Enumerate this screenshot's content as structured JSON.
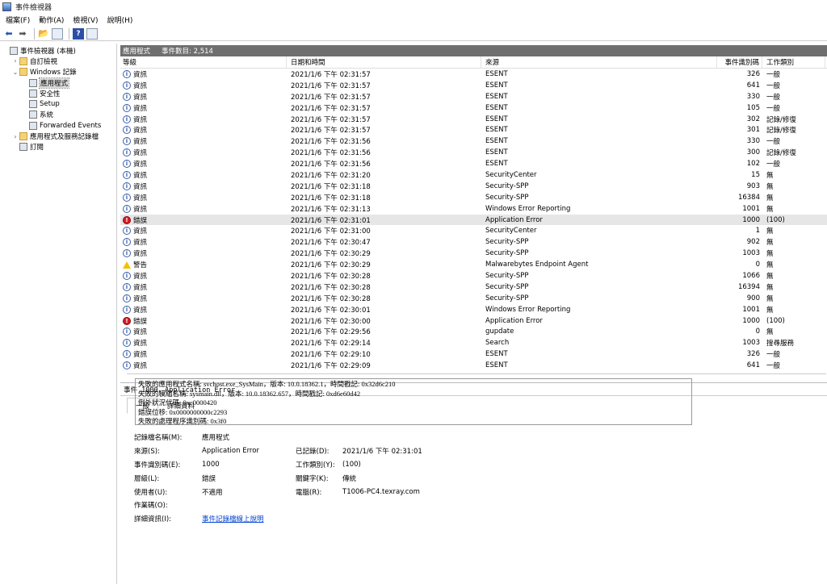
{
  "window": {
    "title": "事件檢視器"
  },
  "menu": [
    "檔案(F)",
    "動作(A)",
    "檢視(V)",
    "說明(H)"
  ],
  "tree": [
    {
      "label": "事件檢視器 (本機)",
      "arrow": "",
      "indent": 0,
      "icon": "app"
    },
    {
      "label": "自訂檢視",
      "arrow": "›",
      "indent": 1,
      "icon": "folder"
    },
    {
      "label": "Windows 記錄",
      "arrow": "⌄",
      "indent": 1,
      "icon": "folder"
    },
    {
      "label": "應用程式",
      "arrow": "",
      "indent": 2,
      "icon": "log",
      "selected": true
    },
    {
      "label": "安全性",
      "arrow": "",
      "indent": 2,
      "icon": "log"
    },
    {
      "label": "Setup",
      "arrow": "",
      "indent": 2,
      "icon": "log"
    },
    {
      "label": "系統",
      "arrow": "",
      "indent": 2,
      "icon": "log"
    },
    {
      "label": "Forwarded Events",
      "arrow": "",
      "indent": 2,
      "icon": "log"
    },
    {
      "label": "應用程式及服務記錄檔",
      "arrow": "›",
      "indent": 1,
      "icon": "folder"
    },
    {
      "label": "訂閱",
      "arrow": "",
      "indent": 1,
      "icon": "log"
    }
  ],
  "pane": {
    "log_name": "應用程式",
    "count_label": "事件數目: 2,514"
  },
  "columns": [
    "等級",
    "日期和時間",
    "來源",
    "事件識別碼",
    "工作類別"
  ],
  "events": [
    {
      "level": "info",
      "level_label": "資訊",
      "time": "2021/1/6 下午 02:31:57",
      "source": "ESENT",
      "id": "326",
      "task": "一般"
    },
    {
      "level": "info",
      "level_label": "資訊",
      "time": "2021/1/6 下午 02:31:57",
      "source": "ESENT",
      "id": "641",
      "task": "一般"
    },
    {
      "level": "info",
      "level_label": "資訊",
      "time": "2021/1/6 下午 02:31:57",
      "source": "ESENT",
      "id": "330",
      "task": "一般"
    },
    {
      "level": "info",
      "level_label": "資訊",
      "time": "2021/1/6 下午 02:31:57",
      "source": "ESENT",
      "id": "105",
      "task": "一般"
    },
    {
      "level": "info",
      "level_label": "資訊",
      "time": "2021/1/6 下午 02:31:57",
      "source": "ESENT",
      "id": "302",
      "task": "記錄/修復"
    },
    {
      "level": "info",
      "level_label": "資訊",
      "time": "2021/1/6 下午 02:31:57",
      "source": "ESENT",
      "id": "301",
      "task": "記錄/修復"
    },
    {
      "level": "info",
      "level_label": "資訊",
      "time": "2021/1/6 下午 02:31:56",
      "source": "ESENT",
      "id": "330",
      "task": "一般"
    },
    {
      "level": "info",
      "level_label": "資訊",
      "time": "2021/1/6 下午 02:31:56",
      "source": "ESENT",
      "id": "300",
      "task": "記錄/修復"
    },
    {
      "level": "info",
      "level_label": "資訊",
      "time": "2021/1/6 下午 02:31:56",
      "source": "ESENT",
      "id": "102",
      "task": "一般"
    },
    {
      "level": "info",
      "level_label": "資訊",
      "time": "2021/1/6 下午 02:31:20",
      "source": "SecurityCenter",
      "id": "15",
      "task": "無"
    },
    {
      "level": "info",
      "level_label": "資訊",
      "time": "2021/1/6 下午 02:31:18",
      "source": "Security-SPP",
      "id": "903",
      "task": "無"
    },
    {
      "level": "info",
      "level_label": "資訊",
      "time": "2021/1/6 下午 02:31:18",
      "source": "Security-SPP",
      "id": "16384",
      "task": "無"
    },
    {
      "level": "info",
      "level_label": "資訊",
      "time": "2021/1/6 下午 02:31:13",
      "source": "Windows Error Reporting",
      "id": "1001",
      "task": "無"
    },
    {
      "level": "err",
      "level_label": "錯誤",
      "time": "2021/1/6 下午 02:31:01",
      "source": "Application Error",
      "id": "1000",
      "task": "(100)",
      "highlight": true
    },
    {
      "level": "info",
      "level_label": "資訊",
      "time": "2021/1/6 下午 02:31:00",
      "source": "SecurityCenter",
      "id": "1",
      "task": "無"
    },
    {
      "level": "info",
      "level_label": "資訊",
      "time": "2021/1/6 下午 02:30:47",
      "source": "Security-SPP",
      "id": "902",
      "task": "無"
    },
    {
      "level": "info",
      "level_label": "資訊",
      "time": "2021/1/6 下午 02:30:29",
      "source": "Security-SPP",
      "id": "1003",
      "task": "無"
    },
    {
      "level": "warn",
      "level_label": "警告",
      "time": "2021/1/6 下午 02:30:29",
      "source": "Malwarebytes Endpoint Agent",
      "id": "0",
      "task": "無"
    },
    {
      "level": "info",
      "level_label": "資訊",
      "time": "2021/1/6 下午 02:30:28",
      "source": "Security-SPP",
      "id": "1066",
      "task": "無"
    },
    {
      "level": "info",
      "level_label": "資訊",
      "time": "2021/1/6 下午 02:30:28",
      "source": "Security-SPP",
      "id": "16394",
      "task": "無"
    },
    {
      "level": "info",
      "level_label": "資訊",
      "time": "2021/1/6 下午 02:30:28",
      "source": "Security-SPP",
      "id": "900",
      "task": "無"
    },
    {
      "level": "info",
      "level_label": "資訊",
      "time": "2021/1/6 下午 02:30:01",
      "source": "Windows Error Reporting",
      "id": "1001",
      "task": "無"
    },
    {
      "level": "err",
      "level_label": "錯誤",
      "time": "2021/1/6 下午 02:30:00",
      "source": "Application Error",
      "id": "1000",
      "task": "(100)"
    },
    {
      "level": "info",
      "level_label": "資訊",
      "time": "2021/1/6 下午 02:29:56",
      "source": "gupdate",
      "id": "0",
      "task": "無"
    },
    {
      "level": "info",
      "level_label": "資訊",
      "time": "2021/1/6 下午 02:29:14",
      "source": "Search",
      "id": "1003",
      "task": "搜尋服務"
    },
    {
      "level": "info",
      "level_label": "資訊",
      "time": "2021/1/6 下午 02:29:10",
      "source": "ESENT",
      "id": "326",
      "task": "一般"
    },
    {
      "level": "info",
      "level_label": "資訊",
      "time": "2021/1/6 下午 02:29:09",
      "source": "ESENT",
      "id": "641",
      "task": "一般"
    }
  ],
  "detail": {
    "header": "事件 1000，Application Error",
    "tabs": [
      "一般",
      "詳細資料"
    ],
    "description": [
      "失敗的應用程式名稱: svchost.exe_SysMain，版本: 10.0.18362.1，時間戳記: 0x32d6c210",
      "失敗的模組名稱: sysmain.dll，版本: 10.0.18362.657，時間戳記: 0xd6e60d42",
      "例外狀況代碼: 0xc0000420",
      "錯誤位移: 0x0000000000c2293",
      "失敗的處理程序識別碼: 0x3f0"
    ],
    "props": {
      "log_name_label": "記錄檔名稱(M):",
      "log_name": "應用程式",
      "source_label": "來源(S):",
      "source": "Application Error",
      "logged_label": "已記錄(D):",
      "logged": "2021/1/6 下午 02:31:01",
      "event_id_label": "事件識別碼(E):",
      "event_id": "1000",
      "task_label": "工作類別(Y):",
      "task": "(100)",
      "level_label": "層級(L):",
      "level": "錯誤",
      "keywords_label": "關鍵字(K):",
      "keywords": "傳統",
      "user_label": "使用者(U):",
      "user": "不適用",
      "computer_label": "電腦(R):",
      "computer": "T1006-PC4.texray.com",
      "opcode_label": "作業碼(O):",
      "opcode": "",
      "more_label": "詳細資訊(I):",
      "more_link": "事件記錄檔線上說明"
    }
  }
}
